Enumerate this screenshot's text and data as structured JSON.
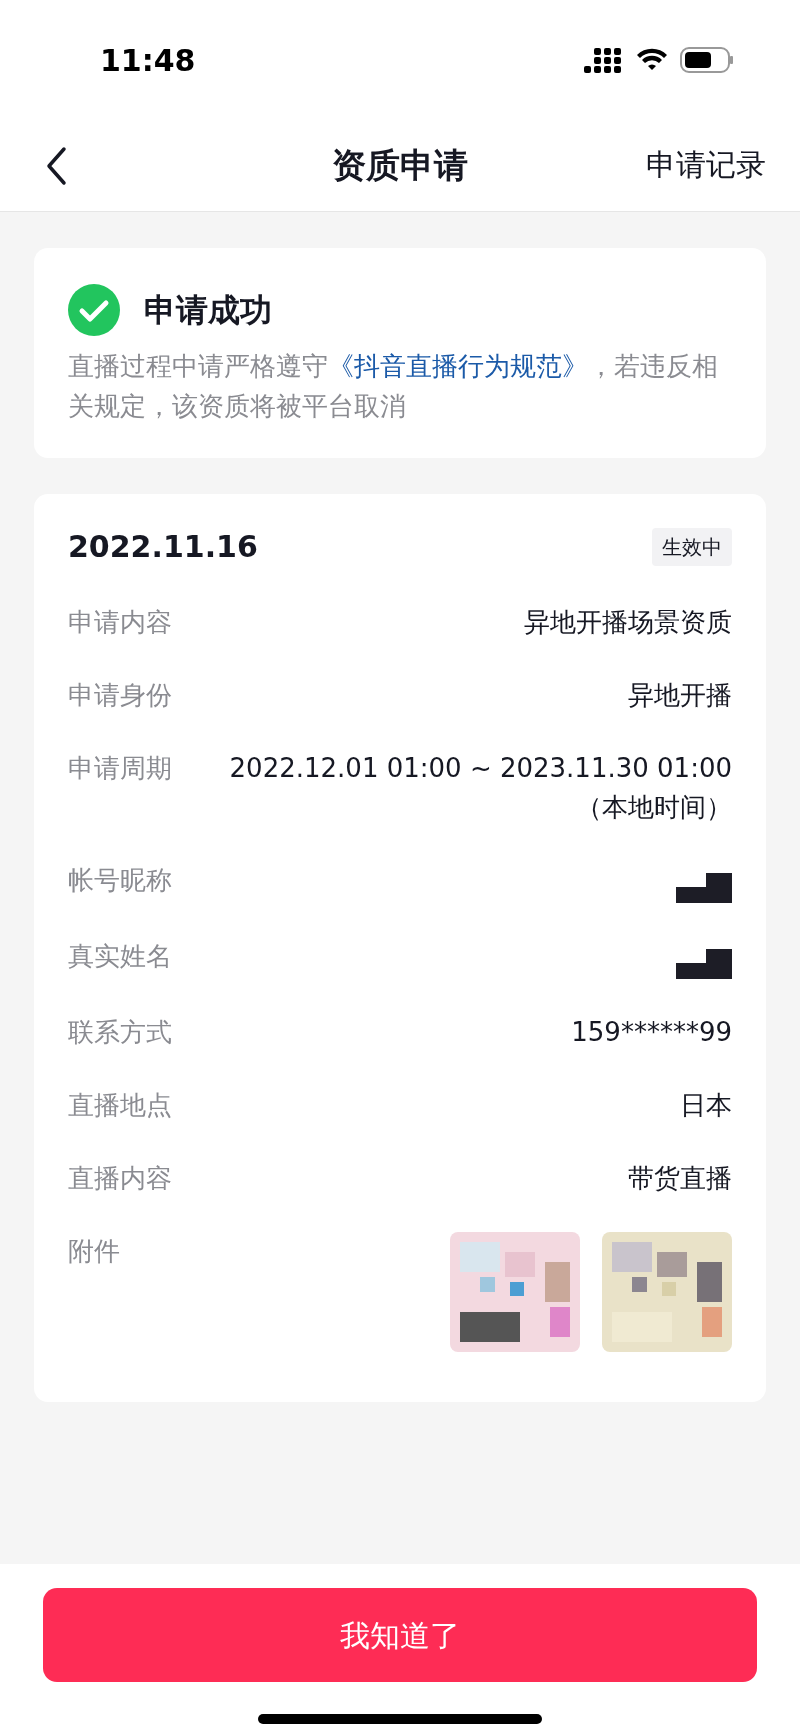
{
  "status_bar": {
    "time": "11:48"
  },
  "nav": {
    "title": "资质申请",
    "action": "申请记录"
  },
  "notice": {
    "title": "申请成功",
    "text_before": "直播过程中请严格遵守",
    "link": "《抖音直播行为规范》",
    "text_after": "，若违反相关规定，该资质将被平台取消"
  },
  "record": {
    "date": "2022.11.16",
    "status": "生效中",
    "rows": [
      {
        "kind": "text",
        "label": "申请内容",
        "value": "异地开播场景资质"
      },
      {
        "kind": "text",
        "label": "申请身份",
        "value": "异地开播"
      },
      {
        "kind": "period",
        "label": "申请周期",
        "value": "2022.12.01 01:00 ~ 2023.11.30 01:00",
        "note": "（本地时间）"
      },
      {
        "kind": "redacted",
        "label": "帐号昵称"
      },
      {
        "kind": "redacted",
        "label": "真实姓名"
      },
      {
        "kind": "text",
        "label": "联系方式",
        "value": "159******99"
      },
      {
        "kind": "text",
        "label": "直播地点",
        "value": "日本"
      },
      {
        "kind": "text",
        "label": "直播内容",
        "value": "带货直播"
      },
      {
        "kind": "attachments",
        "label": "附件"
      }
    ]
  },
  "footer": {
    "button": "我知道了"
  }
}
